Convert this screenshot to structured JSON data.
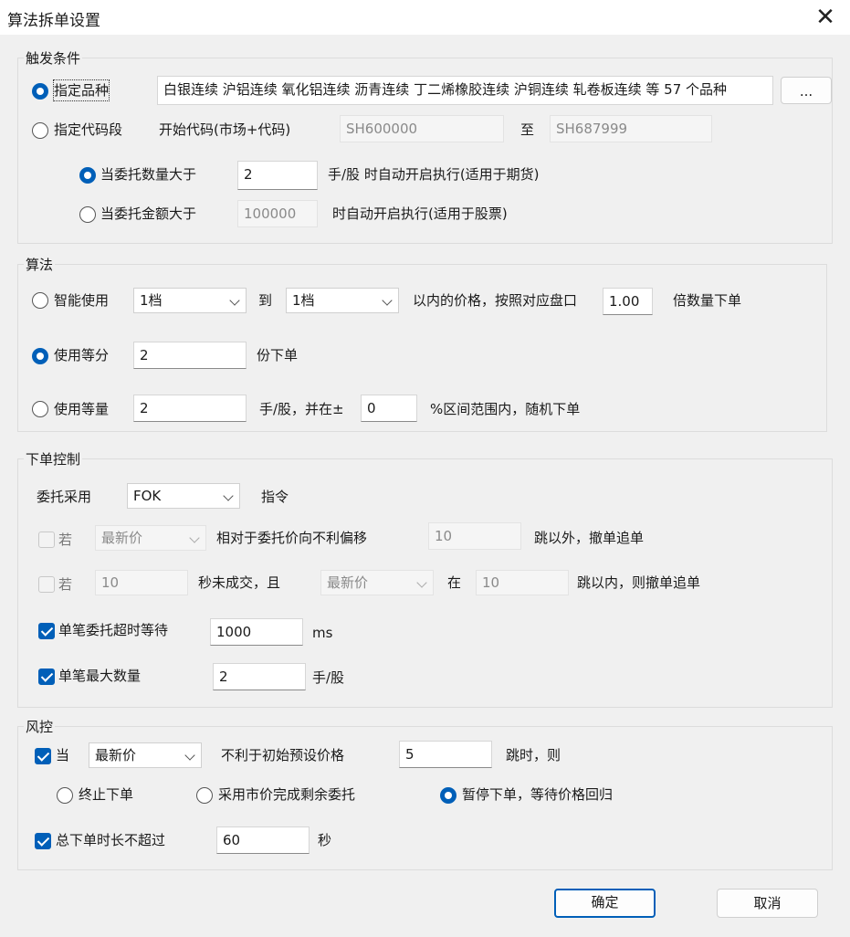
{
  "window": {
    "title": "算法拆单设置"
  },
  "trigger": {
    "title": "触发条件",
    "opt_variety": "指定品种",
    "variety_list": "白银连续 沪铝连续 氧化铝连续 沥青连续 丁二烯橡胶连续 沪铜连续 轧卷板连续 等 57 个品种",
    "browse_button": "...",
    "opt_code_range": "指定代码段",
    "start_code_label": "开始代码(市场+代码)",
    "start_code": "SH600000",
    "to_label": "至",
    "end_code": "SH687999",
    "qty_option": "当委托数量大于",
    "qty_value": "2",
    "qty_suffix": "手/股 时自动开启执行(适用于期货)",
    "amount_option": "当委托金额大于",
    "amount_value": "100000",
    "amount_suffix": "时自动开启执行(适用于股票)"
  },
  "algorithm": {
    "title": "算法",
    "smart_label": "智能使用",
    "smart_from": "1档",
    "to_label": "到",
    "smart_to": "1档",
    "smart_mid": "以内的价格，按照对应盘口",
    "multiplier": "1.00",
    "smart_suffix": "倍数量下单",
    "equal_parts_label": "使用等分",
    "equal_parts_value": "2",
    "equal_parts_suffix": "份下单",
    "equal_qty_label": "使用等量",
    "equal_qty_value": "2",
    "equal_qty_mid": "手/股，并在±",
    "range_value": "0",
    "equal_qty_suffix": "%区间范围内，随机下单"
  },
  "order_control": {
    "title": "下单控制",
    "entrust_label": "委托采用",
    "entrust_type": "FOK",
    "entrust_suffix": "指令",
    "row1_label": "若",
    "row1_price": "最新价",
    "row1_mid": "相对于委托价向不利偏移",
    "row1_ticks": "10",
    "row1_suffix": "跳以外，撤单追单",
    "row2_label": "若",
    "row2_seconds": "10",
    "row2_mid": "秒未成交，且",
    "row2_price": "最新价",
    "row2_in": "在",
    "row2_ticks": "10",
    "row2_suffix": "跳以内，则撤单追单",
    "timeout_label": "单笔委托超时等待",
    "timeout_value": "1000",
    "timeout_unit": "ms",
    "max_qty_label": "单笔最大数量",
    "max_qty_value": "2",
    "max_qty_unit": "手/股"
  },
  "risk": {
    "title": "风控",
    "when_label": "当",
    "price_type": "最新价",
    "when_mid": "不利于初始预设价格",
    "ticks_value": "5",
    "when_suffix": "跳时，则",
    "stop_label": "终止下单",
    "market_label": "采用市价完成剩余委托",
    "pause_label": "暂停下单，等待价格回归",
    "duration_label": "总下单时长不超过",
    "duration_value": "60",
    "duration_unit": "秒"
  },
  "buttons": {
    "ok": "确定",
    "cancel": "取消"
  },
  "colors": {
    "accent": "#005fb8",
    "background": "#f0f0f0"
  }
}
